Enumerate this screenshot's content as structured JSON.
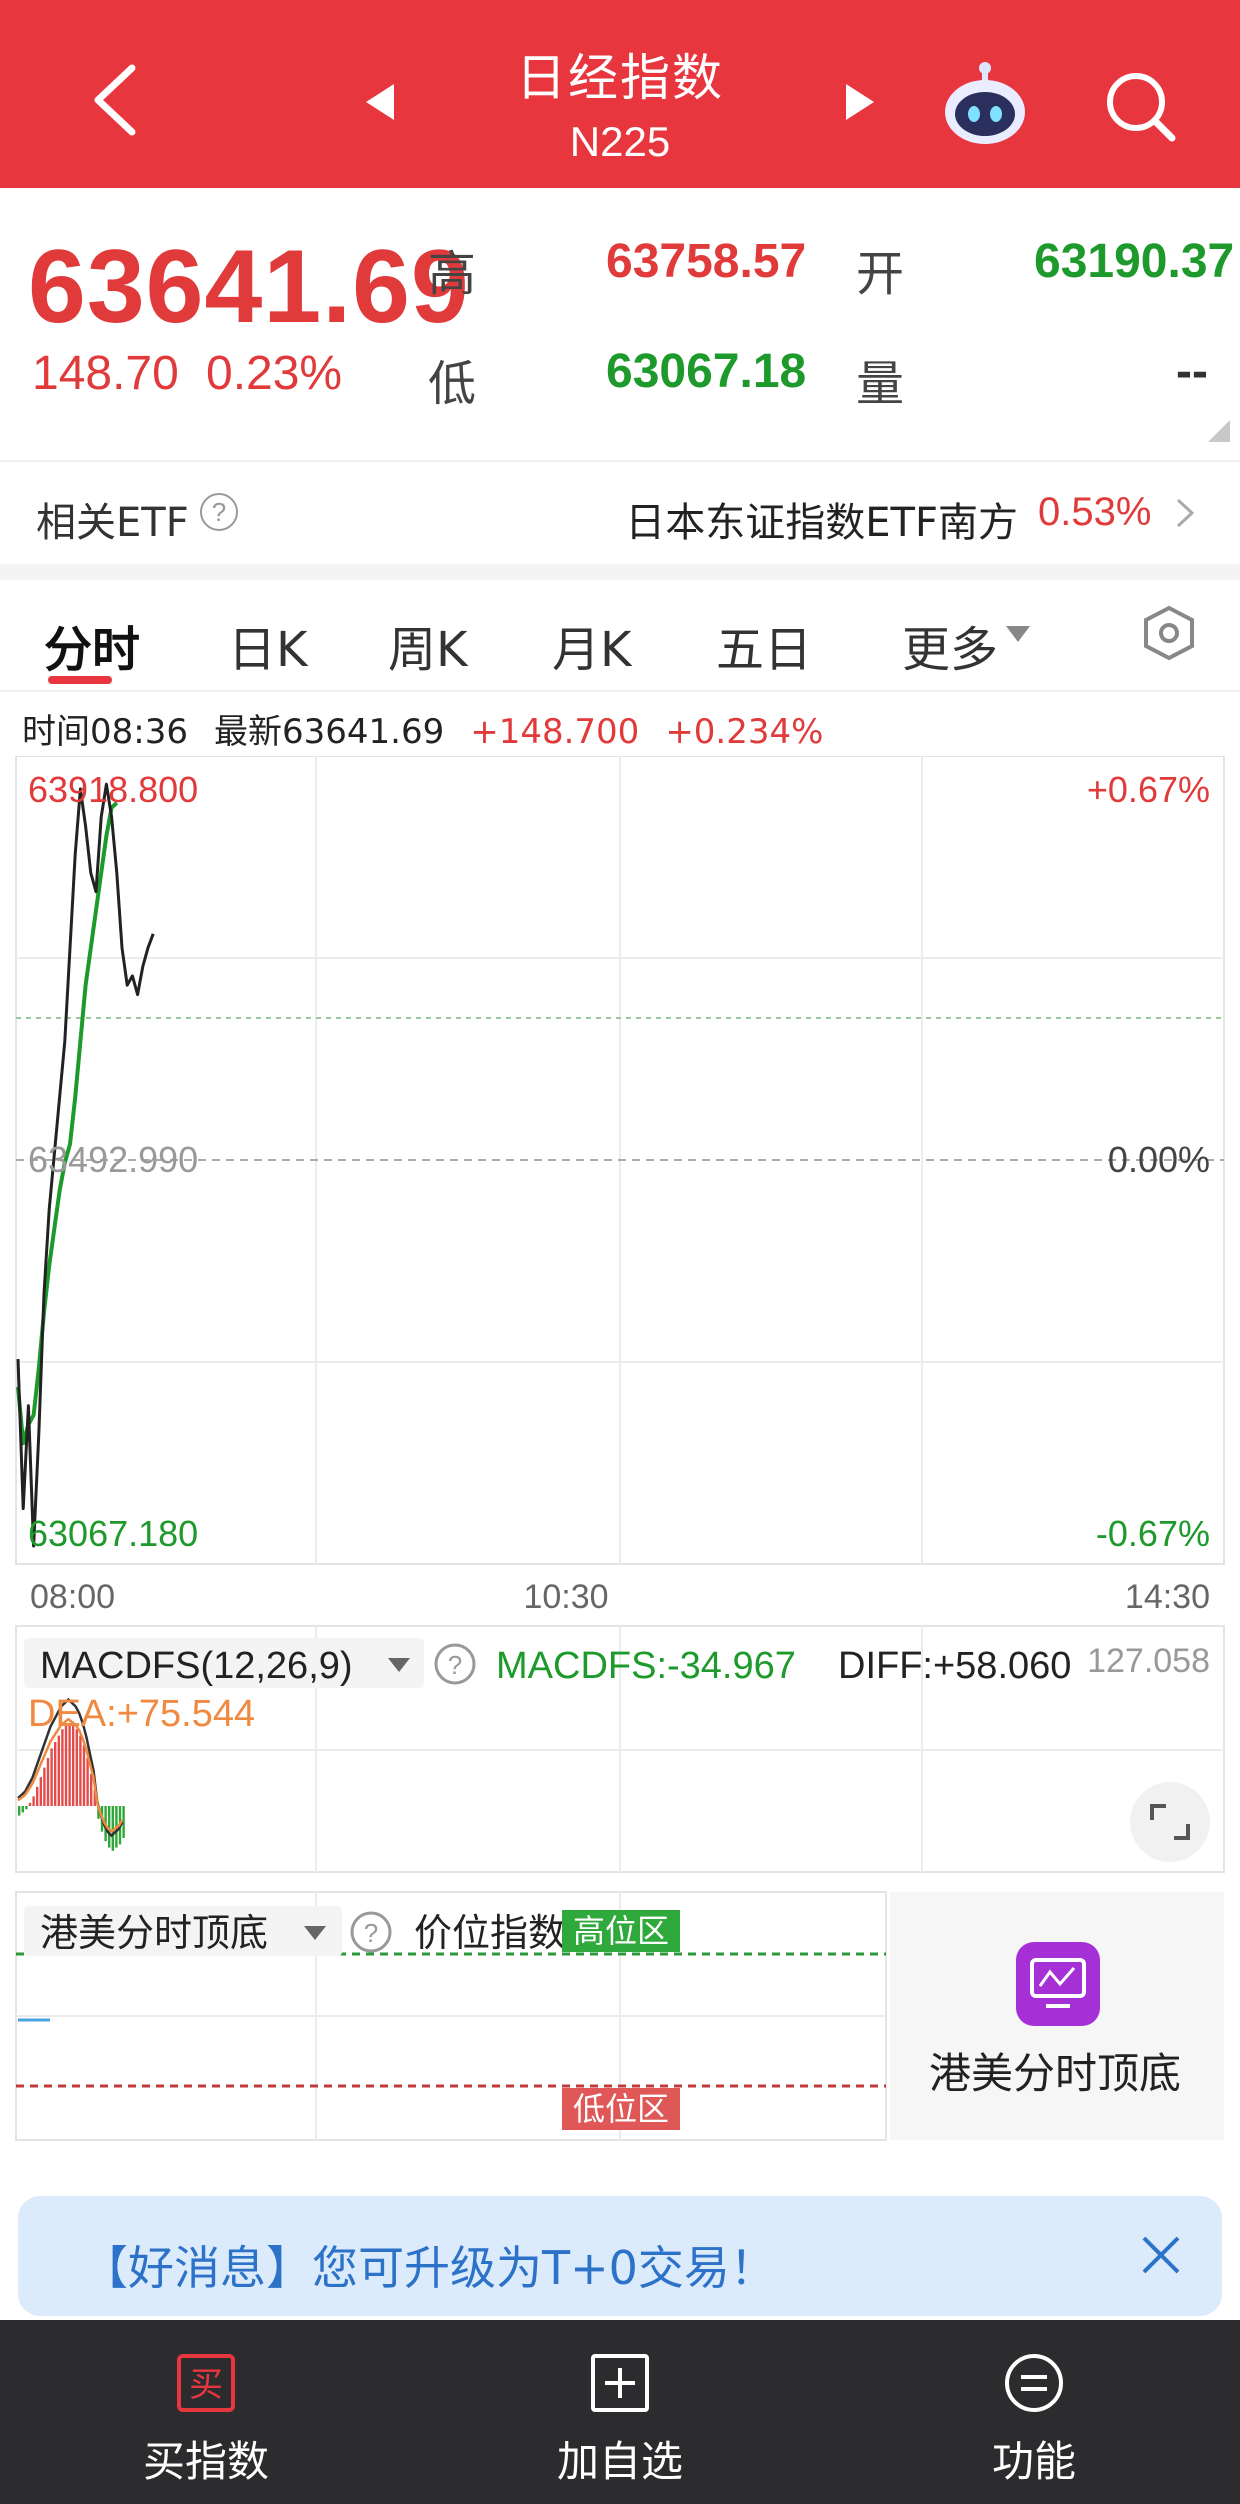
{
  "header": {
    "title": "日经指数",
    "code": "N225",
    "bg_color": "#e8363f"
  },
  "quote": {
    "price": "63641.69",
    "change": "148.70",
    "change_pct": "0.23%",
    "high_label": "高",
    "high_value": "63758.57",
    "open_label": "开",
    "open_value": "63190.37",
    "low_label": "低",
    "low_value": "63067.18",
    "volume_label": "量",
    "volume_value": "--"
  },
  "etf": {
    "label": "相关ETF",
    "help": "?",
    "name": "日本东证指数ETF南方",
    "pct": "0.53%"
  },
  "tabs": [
    {
      "label": "分时"
    },
    {
      "label": "日K"
    },
    {
      "label": "周K"
    },
    {
      "label": "月K"
    },
    {
      "label": "五日"
    },
    {
      "label": "更多"
    }
  ],
  "info_line": {
    "time": "时间08:36",
    "latest": "最新63641.69",
    "change": "+148.700",
    "change_pct": "+0.234%"
  },
  "chart_data": {
    "type": "line",
    "y_top_label": "63918.800",
    "y_mid_label": "63492.990",
    "y_bottom_label": "63067.180",
    "pct_top_label": "+0.67%",
    "pct_mid_label": "0.00%",
    "pct_bottom_label": "-0.67%",
    "ylim": [
      63067.18,
      63918.8
    ],
    "x_tick_labels": [
      "08:00",
      "10:30",
      "14:30"
    ],
    "price_series": [
      63280,
      63120,
      63230,
      63080,
      63200,
      63350,
      63440,
      63500,
      63560,
      63620,
      63720,
      63820,
      63890,
      63850,
      63800,
      63780,
      63860,
      63895,
      63860,
      63800,
      63720,
      63680,
      63690,
      63670,
      63700,
      63720,
      63735
    ],
    "avg_series": [
      63250,
      63190,
      63210,
      63220,
      63270,
      63330,
      63380,
      63420,
      63460,
      63490,
      63510,
      63560,
      63620,
      63680,
      63720,
      63760,
      63800,
      63840,
      63870,
      63875
    ]
  },
  "macd": {
    "selector_label": "MACDFS(12,26,9)",
    "help": "?",
    "macdfs_text": "MACDFS:-34.967",
    "diff_text": "DIFF:+58.060",
    "dea_text": "DEA:+75.544",
    "axis_value": "127.058",
    "bars": [
      -3,
      -2,
      -1,
      1,
      3,
      6,
      9,
      12,
      15,
      18,
      20,
      22,
      24,
      25,
      26,
      25,
      24,
      22,
      19,
      15,
      10,
      5,
      -4,
      -8,
      -11,
      -13,
      -14,
      -13,
      -12,
      -10
    ],
    "colors": {
      "up": "#e44b4b",
      "down": "#2ea836",
      "diff_line": "#333333",
      "dea_line": "#f08a40"
    }
  },
  "price_level": {
    "selector_label": "港美分时顶底",
    "help": "?",
    "title": "价位指数",
    "high_zone": "高位区",
    "low_zone": "低位区"
  },
  "side_card": {
    "title": "港美分时顶底"
  },
  "promo": {
    "text": "【好消息】您可升级为T+0交易！"
  },
  "bottombar": {
    "buy_label": "买指数",
    "buy_icon_text": "买",
    "add_label": "加自选",
    "func_label": "功能"
  }
}
